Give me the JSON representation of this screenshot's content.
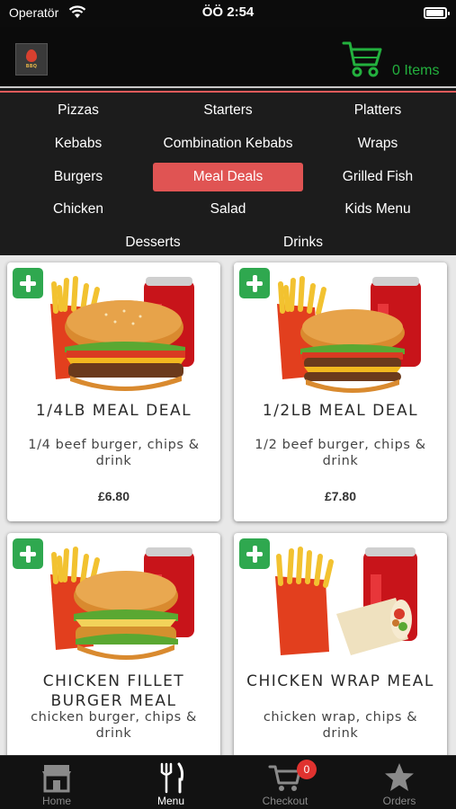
{
  "status_bar": {
    "carrier": "Operatör",
    "time": "ÖÖ 2:54"
  },
  "header": {
    "logo_text": "BBQ",
    "cart_count": "0 Items",
    "icons": {
      "cart": "shopping-cart-icon"
    },
    "colors": {
      "cart": "#23b13e"
    }
  },
  "categories": [
    {
      "label": "Pizzas"
    },
    {
      "label": "Starters"
    },
    {
      "label": "Platters"
    },
    {
      "label": "Kebabs"
    },
    {
      "label": "Combination Kebabs"
    },
    {
      "label": "Wraps"
    },
    {
      "label": "Burgers"
    },
    {
      "label": "Meal Deals",
      "selected": true
    },
    {
      "label": "Grilled Fish"
    },
    {
      "label": "Chicken"
    },
    {
      "label": "Salad"
    },
    {
      "label": "Kids Menu"
    },
    {
      "label": "Desserts"
    },
    {
      "label": "Drinks"
    }
  ],
  "selected_color": "#e05453",
  "products": [
    {
      "title": "1/4LB MEAL DEAL",
      "description": "1/4 beef burger, chips & drink",
      "price": "£6.80",
      "image": "burger-fries-cola"
    },
    {
      "title": "1/2LB MEAL DEAL",
      "description": "1/2 beef burger, chips & drink",
      "price": "£7.80",
      "image": "burger-fries-cola"
    },
    {
      "title": "CHICKEN FILLET BURGER MEAL",
      "description": "chicken burger, chips & drink",
      "price": "",
      "image": "chicken-burger-fries-cola"
    },
    {
      "title": "CHICKEN WRAP MEAL",
      "description": "chicken wrap, chips & drink",
      "price": "",
      "image": "wrap-fries-cola"
    }
  ],
  "add_icon": "plus-icon",
  "add_color": "#2fa84f",
  "tabs": [
    {
      "label": "Home",
      "icon": "store-icon"
    },
    {
      "label": "Menu",
      "icon": "fork-knife-icon",
      "active": true
    },
    {
      "label": "Checkout",
      "icon": "cart-icon",
      "badge": "0"
    },
    {
      "label": "Orders",
      "icon": "star-icon"
    }
  ]
}
